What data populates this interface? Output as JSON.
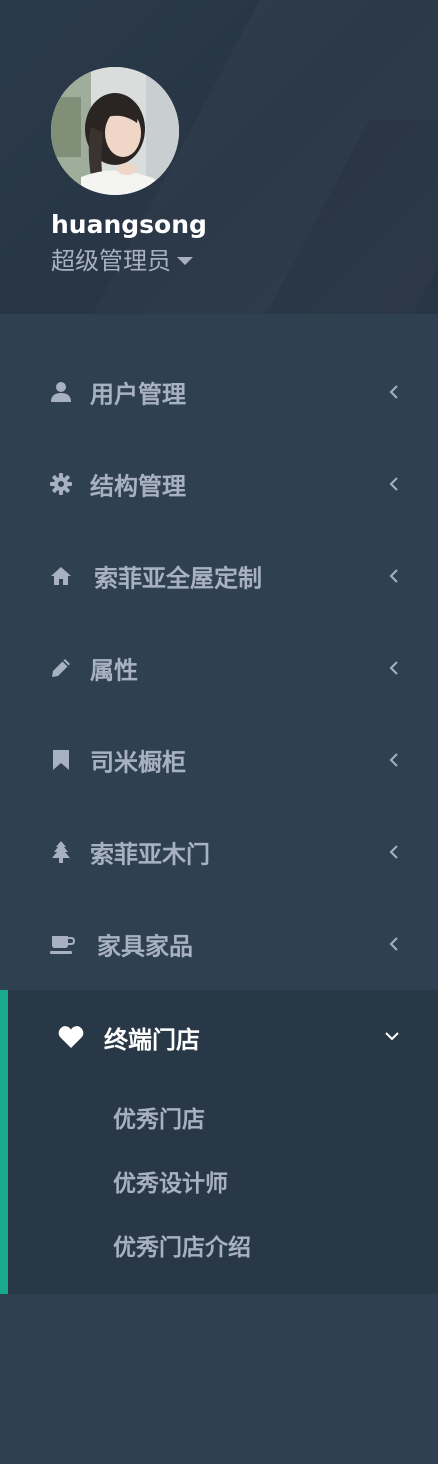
{
  "profile": {
    "username": "huangsong",
    "role": "超级管理员"
  },
  "menu": {
    "items": [
      {
        "label": "用户管理",
        "icon": "user-icon"
      },
      {
        "label": "结构管理",
        "icon": "gear-icon"
      },
      {
        "label": "索菲亚全屋定制",
        "icon": "home-icon"
      },
      {
        "label": "属性",
        "icon": "pencil-icon"
      },
      {
        "label": "司米橱柜",
        "icon": "bookmark-icon"
      },
      {
        "label": "索菲亚木门",
        "icon": "tree-icon"
      },
      {
        "label": "家具家品",
        "icon": "coffee-icon"
      }
    ],
    "active": {
      "label": "终端门店",
      "icon": "heart-icon",
      "children": [
        "优秀门店",
        "优秀设计师",
        "优秀门店介绍"
      ]
    }
  },
  "colors": {
    "sidebar_bg": "#2f4050",
    "active_bg": "#293846",
    "accent": "#19aa8d",
    "text_muted": "#a7b1c2"
  }
}
